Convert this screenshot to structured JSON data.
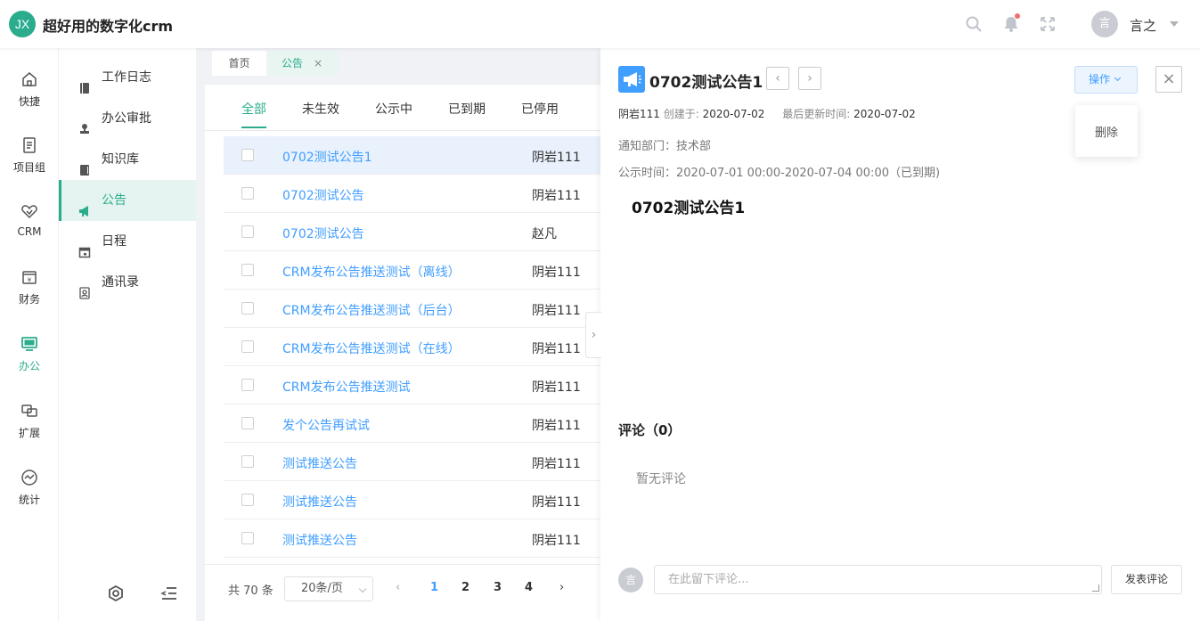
{
  "app": {
    "logo_text": "JX",
    "title": "超好用的数字化crm",
    "accent": "#2aac8d",
    "link_color": "#409eff"
  },
  "header": {
    "icons": [
      "search-icon",
      "bell-icon",
      "fullscreen-icon"
    ],
    "user_avatar": "言",
    "user_name": "言之"
  },
  "rail": {
    "items": [
      {
        "label": "快捷",
        "icon": "home-icon"
      },
      {
        "label": "项目组",
        "icon": "document-icon"
      },
      {
        "label": "CRM",
        "icon": "handshake-icon"
      },
      {
        "label": "财务",
        "icon": "wallet-icon"
      },
      {
        "label": "办公",
        "icon": "monitor-icon",
        "active": true
      },
      {
        "label": "扩展",
        "icon": "extend-icon"
      },
      {
        "label": "统计",
        "icon": "chart-icon"
      }
    ]
  },
  "submenu": {
    "items": [
      {
        "label": "工作日志",
        "icon": "notebook-icon"
      },
      {
        "label": "办公审批",
        "icon": "stamp-icon"
      },
      {
        "label": "知识库",
        "icon": "book-icon"
      },
      {
        "label": "公告",
        "icon": "megaphone-icon",
        "active": true
      },
      {
        "label": "日程",
        "icon": "calendar-icon"
      },
      {
        "label": "通讯录",
        "icon": "contacts-icon"
      }
    ],
    "bottom_icons": [
      "settings-icon",
      "collapse-menu-icon"
    ]
  },
  "tabs": [
    {
      "label": "首页"
    },
    {
      "label": "公告",
      "active": true,
      "close": "×"
    }
  ],
  "filters": [
    "全部",
    "未生效",
    "公示中",
    "已到期",
    "已停用"
  ],
  "list": {
    "rows": [
      {
        "title": "0702测试公告1",
        "author": "阴岩111"
      },
      {
        "title": "0702测试公告",
        "author": "阴岩111"
      },
      {
        "title": "0702测试公告",
        "author": "赵凡"
      },
      {
        "title": "CRM发布公告推送测试（离线）",
        "author": "阴岩111"
      },
      {
        "title": "CRM发布公告推送测试（后台）",
        "author": "阴岩111"
      },
      {
        "title": "CRM发布公告推送测试（在线）",
        "author": "阴岩111"
      },
      {
        "title": "CRM发布公告推送测试",
        "author": "阴岩111"
      },
      {
        "title": "发个公告再试试",
        "author": "阴岩111"
      },
      {
        "title": "测试推送公告",
        "author": "阴岩111"
      },
      {
        "title": "测试推送公告",
        "author": "阴岩111"
      },
      {
        "title": "测试推送公告",
        "author": "阴岩111"
      }
    ]
  },
  "pager": {
    "total": "共 70 条",
    "page_size": "20条/页",
    "prev": "‹",
    "next": "›",
    "pages": [
      "1",
      "2",
      "3",
      "4"
    ],
    "current": "1"
  },
  "detail": {
    "title": "0702测试公告1",
    "prev": "‹",
    "next": "›",
    "author": "阴岩111",
    "created_label": "创建于:",
    "created": "2020-07-02",
    "updated_label": "最后更新时间:",
    "updated": "2020-07-02",
    "dept": "通知部门：技术部",
    "period": "公示时间：2020-07-01 00:00-2020-07-04 00:00（已到期)",
    "content": "0702测试公告1",
    "op_button": "操作",
    "op_menu": [
      "删除"
    ],
    "close": "×",
    "comments_title": "评论（0）",
    "no_comments": "暂无评论",
    "comment_avatar": "言",
    "comment_placeholder": "在此留下评论...",
    "submit": "发表评论"
  }
}
